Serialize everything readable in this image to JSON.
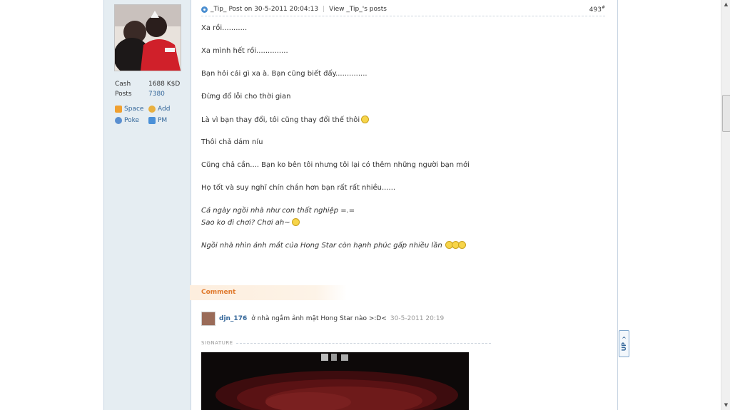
{
  "post": {
    "author": "_Tip_",
    "post_on": "Post on 30-5-2011 20:04:13",
    "view_posts": "View _Tip_'s posts",
    "floor": "493",
    "floor_mark": "#"
  },
  "user": {
    "cash_label": "Cash",
    "cash_value": "1688 K$D",
    "posts_label": "Posts",
    "posts_value": "7380",
    "actions": {
      "space": "Space",
      "add": "Add",
      "poke": "Poke",
      "pm": "PM"
    }
  },
  "message": {
    "lines": [
      "Xa rồi...........",
      "Xa mình hết rồi..............",
      "Bạn hỏi cái gì xa à. Bạn cũng biết đấy..............",
      "Đừng đổ lỗi cho thời gian",
      "Là vì bạn thay đổi, tôi cũng thay đổi thế thôi",
      "Thôi chả dám níu",
      "Cũng chả cần.... Bạn ko bên tôi nhưng tôi lại có thêm những người bạn mới",
      "Họ tốt và suy nghĩ chín chắn hơn bạn rất rất nhiều......"
    ],
    "italic_lines": [
      "Cả ngày ngồi nhà như con thất nghiệp =.=",
      "Sao ko đi chơi? Chơi ah~",
      "Ngồi nhà nhìn ảnh mắt của Hong Star còn hạnh phúc gấp nhiều lần"
    ]
  },
  "comment": {
    "tab_label": "Comment",
    "author": "djn_176",
    "text": "ở nhà ngắm ảnh mặt Hong Star nào >:D<",
    "time": "30-5-2011 20:19"
  },
  "signature": {
    "label": "SIGNATURE"
  },
  "up_button": {
    "label": "UP"
  },
  "colors": {
    "link": "#336699",
    "sidebar_bg": "#e5edf2",
    "comment_accent": "#e07a2e"
  }
}
